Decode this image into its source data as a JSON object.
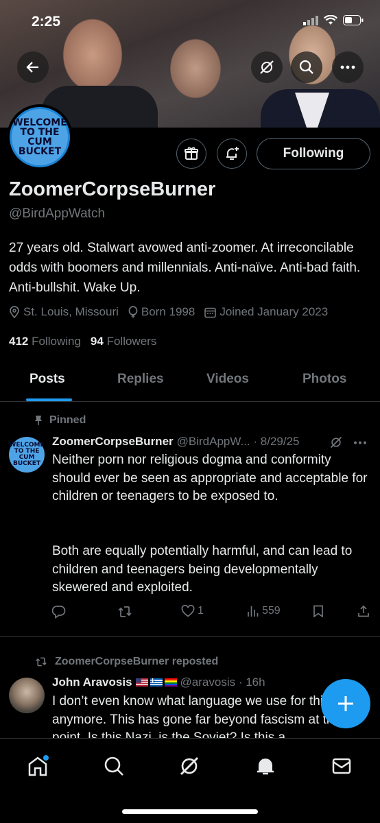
{
  "status_bar": {
    "time": "2:25"
  },
  "profile": {
    "display_name": "ZoomerCorpseBurner",
    "handle": "@BirdAppWatch",
    "avatar_text": "WELCOME TO THE CUM BUCKET",
    "bio": "27 years old. Stalwart avowed anti-zoomer. At irreconcilable odds with boomers and millennials. Anti-naïve. Anti-bad faith. Anti-bullshit. Wake Up.",
    "location": "St. Louis, Missouri",
    "born": "Born 1998",
    "joined": "Joined January 2023",
    "following_count": "412",
    "following_label": "Following",
    "followers_count": "94",
    "followers_label": "Followers",
    "following_button": "Following"
  },
  "tabs": [
    "Posts",
    "Replies",
    "Videos",
    "Photos"
  ],
  "pinned_post": {
    "pinned_label": "Pinned",
    "author": "ZoomerCorpseBurner",
    "handle_date": "@BirdAppW... · 8/29/25",
    "text_p1": "Neither porn nor religious dogma and conformity should ever be seen as appropriate and acceptable for children or teenagers to be exposed to.",
    "text_p2": "Both are equally potentially harmful, and can lead to children and teenagers being developmentally skewered and exploited.",
    "likes": "1",
    "views": "559"
  },
  "repost": {
    "repost_label": "ZoomerCorpseBurner reposted",
    "author": "John Aravosis",
    "handle_date": "@aravosis · 16h",
    "text": "I don’t even know what language we use for this anymore. This has gone far beyond fascism at this point. Is this Nazi, is the Soviet? Is this a"
  },
  "colors": {
    "accent": "#1d9bf0",
    "muted": "#71767b",
    "text": "#e7e9ea"
  },
  "icons": [
    "back-arrow-icon",
    "grok-icon",
    "search-icon",
    "more-icon",
    "gift-icon",
    "bell-plus-icon",
    "location-icon",
    "balloon-icon",
    "calendar-icon",
    "pin-icon",
    "reply-icon",
    "retweet-icon",
    "like-icon",
    "views-icon",
    "bookmark-icon",
    "share-icon",
    "plus-icon",
    "home-icon",
    "explore-icon",
    "notifications-icon",
    "messages-icon"
  ]
}
